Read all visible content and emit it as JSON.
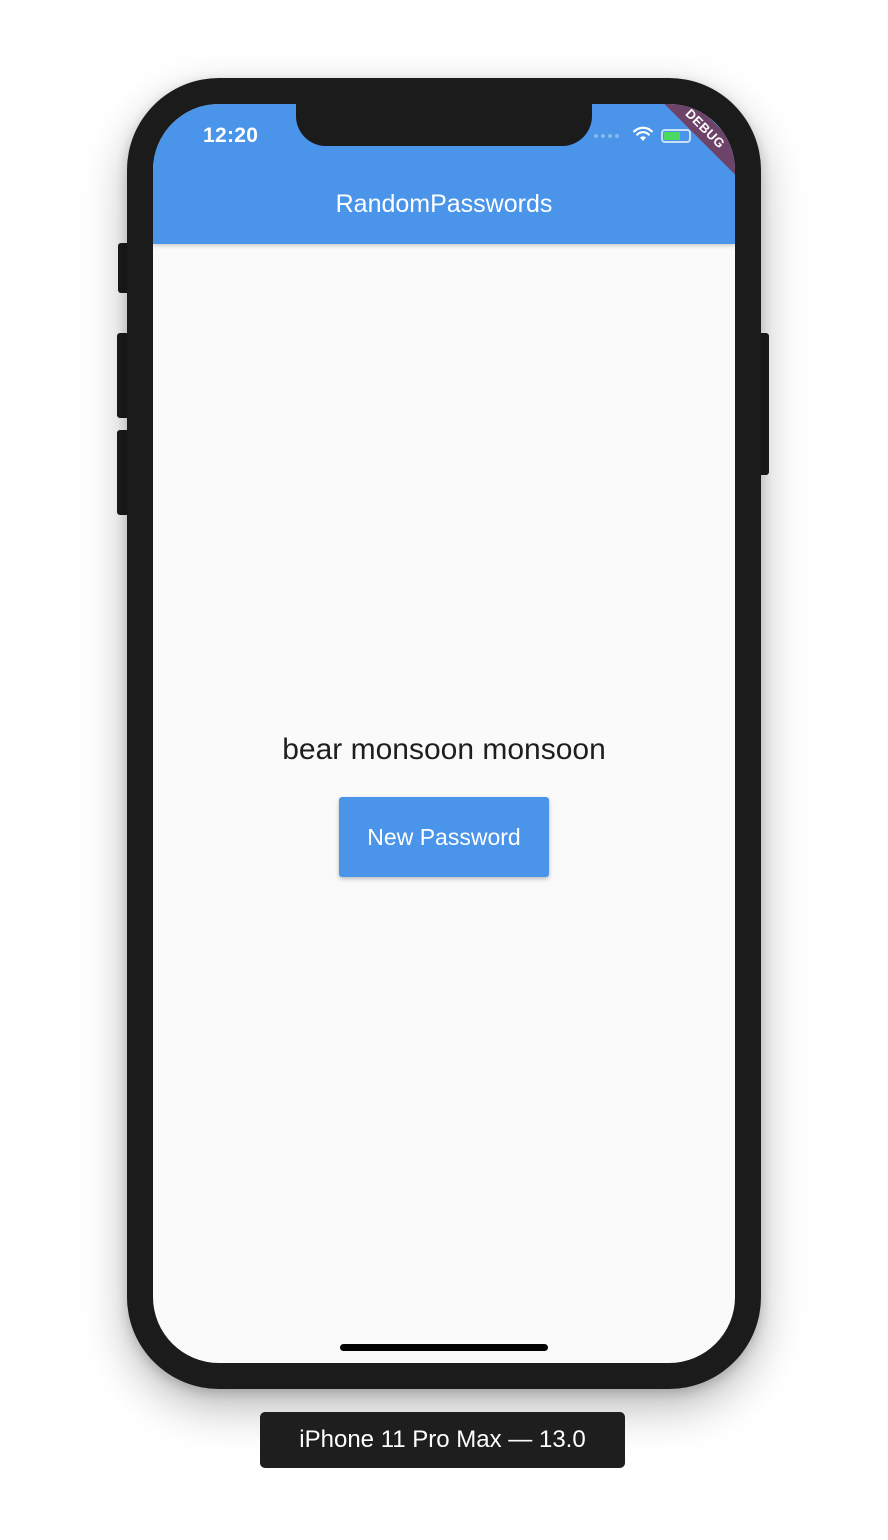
{
  "status_bar": {
    "time": "12:20",
    "icons": [
      "cellular-signal-icon",
      "wifi-icon",
      "battery-charging-icon"
    ]
  },
  "debug_banner": "DEBUG",
  "app_bar": {
    "title": "RandomPasswords"
  },
  "main": {
    "password": "bear monsoon monsoon",
    "button_label": "New Password"
  },
  "device_label": "iPhone 11 Pro Max — 13.0",
  "colors": {
    "primary": "#4a94e9",
    "background": "#fafafa",
    "device_frame": "#1b1b1b"
  }
}
